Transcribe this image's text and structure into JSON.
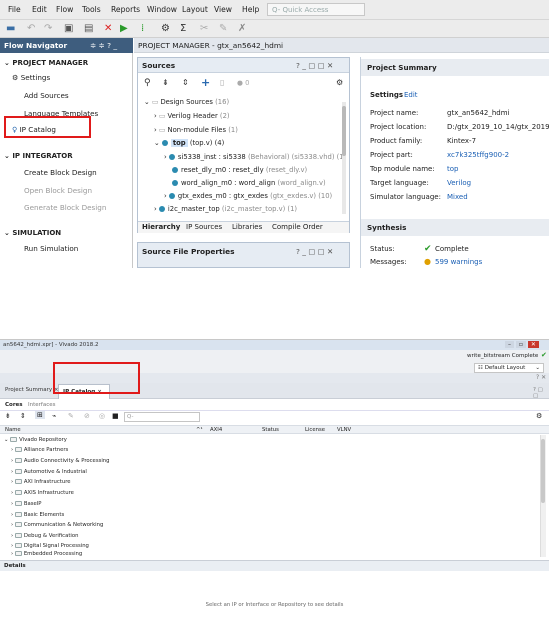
{
  "top": {
    "menu": [
      "File",
      "Edit",
      "Flow",
      "Tools",
      "Reports",
      "Window",
      "Layout",
      "View",
      "Help"
    ],
    "quick_access_placeholder": "Q- Quick Access",
    "flow_navigator": {
      "title": "Flow Navigator",
      "project_manager": "PROJECT MANAGER",
      "settings": "Settings",
      "add_sources": "Add Sources",
      "language_templates": "Language Templates",
      "ip_catalog": "IP Catalog",
      "ip_integrator": "IP INTEGRATOR",
      "create_block_design": "Create Block Design",
      "open_block_design": "Open Block Design",
      "generate_block_design": "Generate Block Design",
      "simulation": "SIMULATION",
      "run_simulation": "Run Simulation"
    },
    "project_manager_title": "PROJECT MANAGER - gtx_an5642_hdmi",
    "sources": {
      "title": "Sources",
      "badge": "0",
      "design_sources": "Design Sources",
      "design_sources_count": "(16)",
      "verilog_header": "Verilog Header",
      "verilog_header_count": "(2)",
      "non_module_files": "Non-module Files",
      "non_module_files_count": "(1)",
      "top": "top",
      "top_detail": "(top.v) (4)",
      "children": [
        {
          "name": "si5338_inst : si5338",
          "detail": "(Behavioral) (si5338.vhd) (1)"
        },
        {
          "name": "reset_dly_m0 : reset_dly",
          "detail": "(reset_dly.v)"
        },
        {
          "name": "word_align_m0 : word_align",
          "detail": "(word_align.v)"
        },
        {
          "name": "gtx_exdes_m0 : gtx_exdes",
          "detail": "(gtx_exdes.v) (10)"
        }
      ],
      "i2c_master": "i2c_master_top",
      "i2c_master_detail": "(i2c_master_top.v) (1)",
      "tabs": [
        "Hierarchy",
        "IP Sources",
        "Libraries",
        "Compile Order"
      ]
    },
    "source_file_properties": "Source File Properties",
    "project_summary": {
      "title": "Project Summary",
      "settings": "Settings",
      "edit": "Edit",
      "rows": [
        {
          "label": "Project name:",
          "value": "gtx_an5642_hdmi"
        },
        {
          "label": "Project location:",
          "value": "D:/gtx_2019_10_14/gtx_2019_10_"
        },
        {
          "label": "Product family:",
          "value": "Kintex-7"
        },
        {
          "label": "Project part:",
          "value": "xc7k325tffg900-2"
        },
        {
          "label": "Top module name:",
          "value": "top"
        },
        {
          "label": "Target language:",
          "value": "Verilog"
        },
        {
          "label": "Simulator language:",
          "value": "Mixed"
        }
      ],
      "synthesis": "Synthesis",
      "status_label": "Status:",
      "status_value": "Complete",
      "messages_label": "Messages:",
      "messages_value": "599 warnings"
    }
  },
  "bottom": {
    "window_title": "an5642_hdmi.xpr] - Vivado 2018.2",
    "status_text": "write_bitstream Complete",
    "layout": "Default Layout",
    "tabs": {
      "project_summary": "Project Summary",
      "ip_catalog": "IP Catalog"
    },
    "cores": "Cores",
    "interfaces": "Interfaces",
    "search_placeholder": "Q-",
    "columns": [
      "Name",
      "AXI4",
      "Status",
      "License",
      "VLNV"
    ],
    "repository": "Vivado Repository",
    "categories": [
      "Alliance Partners",
      "Audio Connectivity & Processing",
      "Automotive & Industrial",
      "AXI Infrastructure",
      "AXIS Infrastructure",
      "BaseIP",
      "Basic Elements",
      "Communication & Networking",
      "Debug & Verification",
      "Digital Signal Processing",
      "Embedded Processing"
    ],
    "details": "Details",
    "details_message": "Select an IP or Interface or Repository to see details"
  }
}
